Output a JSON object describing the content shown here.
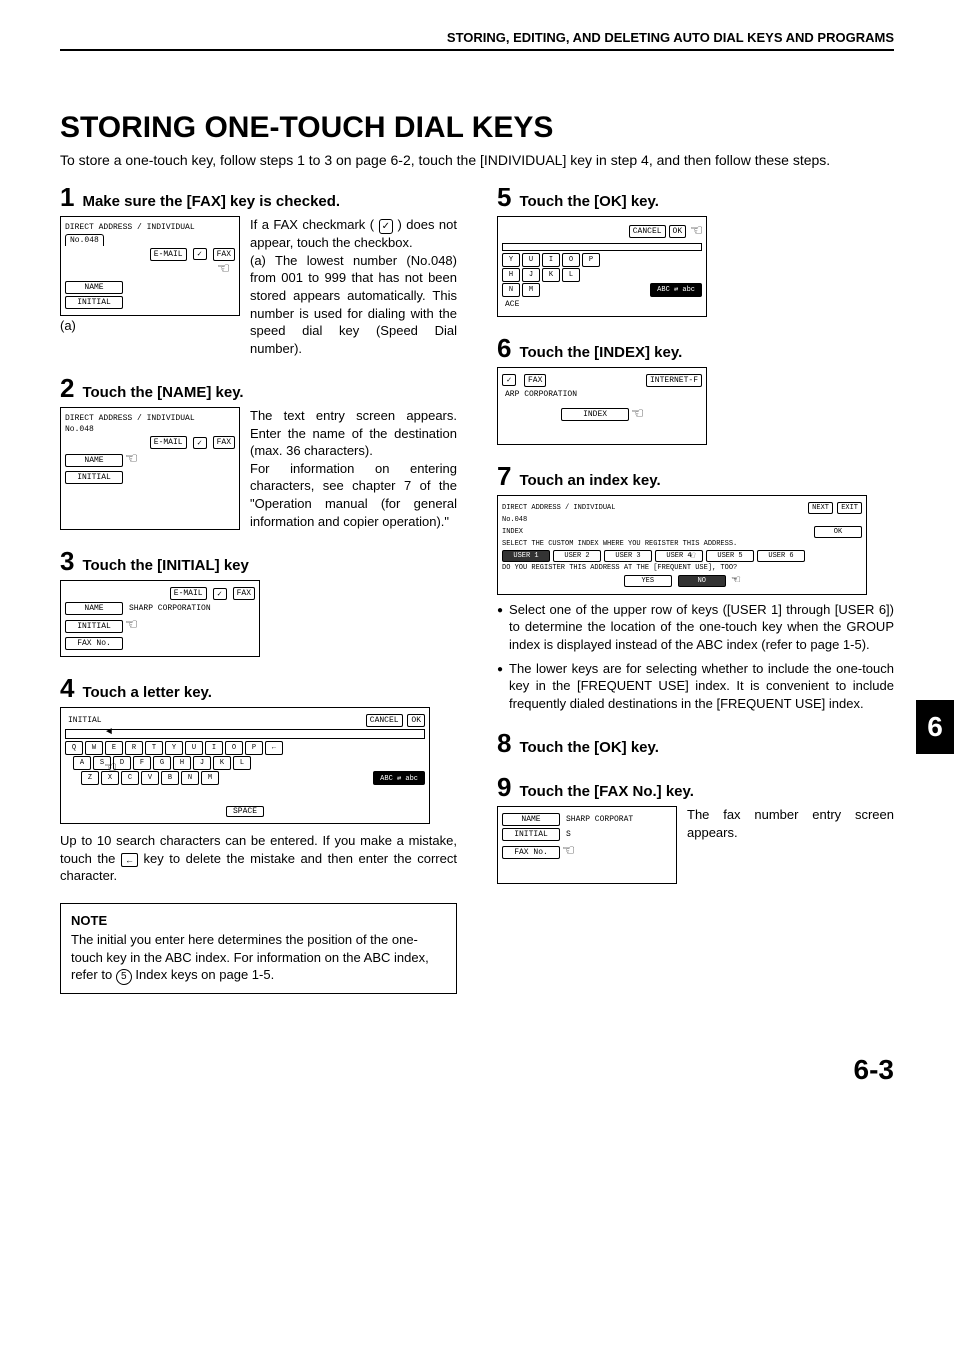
{
  "header": "STORING, EDITING, AND DELETING AUTO DIAL KEYS AND PROGRAMS",
  "title": "STORING ONE-TOUCH DIAL KEYS",
  "intro": "To store a one-touch key, follow steps 1 to 3 on  page 6-2, touch the [INDIVIDUAL] key in step 4, and then follow these steps.",
  "side_tab": "6",
  "page_number": "6-3",
  "circled_ref": "5",
  "steps": {
    "s1": {
      "num": "1",
      "title": "Make sure the [FAX] key is checked.",
      "text_a": "If a FAX checkmark (",
      "text_b": ") does not appear, touch the checkbox.",
      "text_c": "(a) The lowest number (No.048) from 001 to 999 that has not been stored appears automatically. This number is used for dialing with the speed dial key (Speed Dial number).",
      "caption": "(a)",
      "screen": {
        "head": "DIRECT ADDRESS / INDIVIDUAL",
        "no": "No.048",
        "email": "E-MAIL",
        "fax": "FAX",
        "name": "NAME",
        "initial": "INITIAL"
      }
    },
    "s2": {
      "num": "2",
      "title": "Touch the [NAME] key.",
      "text_a": "The text entry screen appears. Enter the name of the destination (max. 36 characters).",
      "text_b": "For information on entering characters, see chapter 7 of the \"Operation manual (for general information and copier operation).\"",
      "screen": {
        "head": "DIRECT ADDRESS / INDIVIDUAL",
        "no": "No.048",
        "email": "E-MAIL",
        "fax": "FAX",
        "name": "NAME",
        "initial": "INITIAL"
      }
    },
    "s3": {
      "num": "3",
      "title": "Touch the [INITIAL] key",
      "screen": {
        "email": "E-MAIL",
        "fax": "FAX",
        "name": "NAME",
        "corp": "SHARP CORPORATION",
        "initial": "INITIAL",
        "faxno": "FAX No."
      }
    },
    "s4": {
      "num": "4",
      "title": "Touch a letter key.",
      "text": "Up to 10 search characters can be entered. If you make a mistake, touch the ",
      "text_b": " key to delete the mistake and then enter the correct character.",
      "screen": {
        "initial": "INITIAL",
        "cancel": "CANCEL",
        "ok": "OK",
        "space": "SPACE",
        "abc": "ABC ⇄ abc",
        "rows": [
          [
            "Q",
            "W",
            "E",
            "R",
            "T",
            "Y",
            "U",
            "I",
            "O",
            "P",
            "←"
          ],
          [
            "A",
            "S",
            "D",
            "F",
            "G",
            "H",
            "J",
            "K",
            "L"
          ],
          [
            "Z",
            "X",
            "C",
            "V",
            "B",
            "N",
            "M"
          ]
        ]
      }
    },
    "s5": {
      "num": "5",
      "title": "Touch the [OK] key.",
      "screen": {
        "cancel": "CANCEL",
        "ok": "OK",
        "abc": "ABC ⇄ abc",
        "ace": "ACE",
        "rows": [
          [
            "Y",
            "U",
            "I",
            "O",
            "P"
          ],
          [
            "H",
            "J",
            "K",
            "L"
          ],
          [
            "N",
            "M"
          ]
        ]
      }
    },
    "s6": {
      "num": "6",
      "title": "Touch the [INDEX] key.",
      "screen": {
        "fax": "FAX",
        "internet": "INTERNET-F",
        "corp": "ARP CORPORATION",
        "index": "INDEX"
      }
    },
    "s7": {
      "num": "7",
      "title": "Touch an index key.",
      "bullet1": "Select one of the upper row of keys ([USER 1] through [USER 6]) to determine the location of the one-touch key when the GROUP index is displayed instead of the ABC index (refer to page 1-5).",
      "bullet2": "The lower keys are for selecting whether to include the one-touch key in the [FREQUENT USE] index. It is convenient to include frequently dialed destinations in the [FREQUENT USE] index.",
      "screen": {
        "head": "DIRECT ADDRESS / INDIVIDUAL",
        "next": "NEXT",
        "exit": "EXIT",
        "no": "No.048",
        "index": "INDEX",
        "ok": "OK",
        "line1": "SELECT THE CUSTOM INDEX WHERE YOU REGISTER THIS ADDRESS.",
        "users": [
          "USER 1",
          "USER 2",
          "USER 3",
          "USER 4",
          "USER 5",
          "USER 6"
        ],
        "line2": "DO YOU REGISTER THIS ADDRESS AT THE [FREQUENT USE], TOO?",
        "yes": "YES",
        "noBtn": "NO"
      }
    },
    "s8": {
      "num": "8",
      "title": "Touch the [OK] key."
    },
    "s9": {
      "num": "9",
      "title": "Touch the [FAX No.] key.",
      "text": "The fax number entry screen appears.",
      "screen": {
        "name": "NAME",
        "corp": "SHARP CORPORAT",
        "initial": "INITIAL",
        "s": "S",
        "faxno": "FAX No."
      }
    }
  },
  "note": {
    "label": "NOTE",
    "text_a": "The initial you enter here determines the position of the one-touch key in the ABC index. For information on the ABC index, refer to ",
    "text_b": " Index keys on page 1-5."
  }
}
